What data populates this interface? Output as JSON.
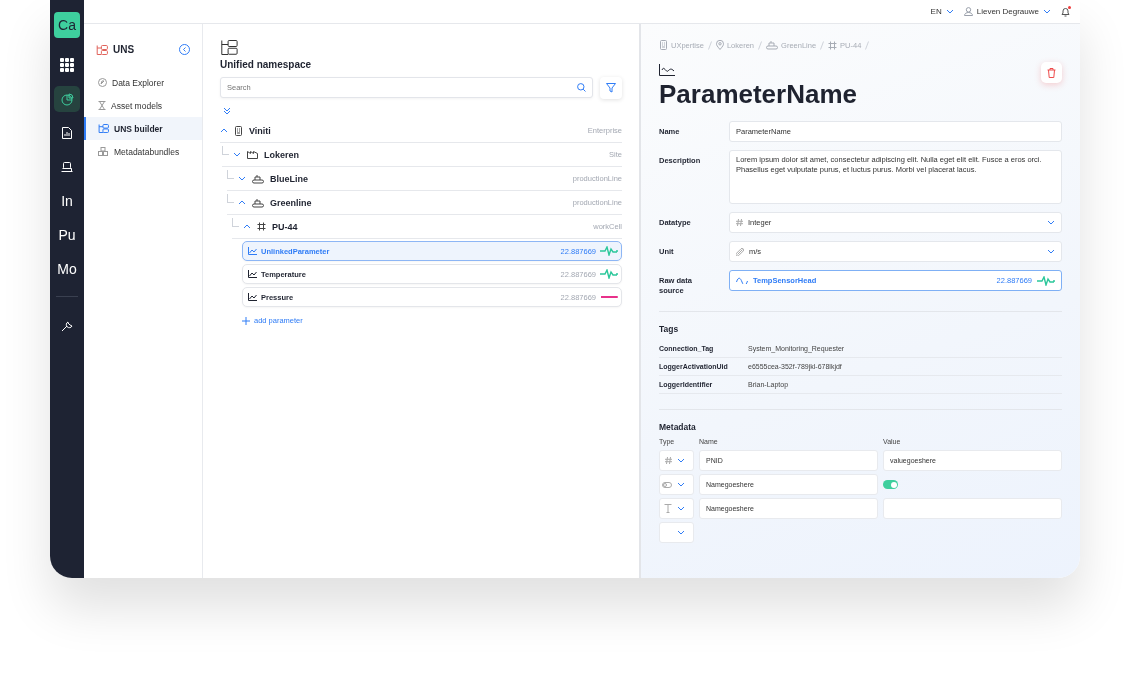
{
  "rail": {
    "logo": "Ca",
    "items": [
      {
        "kind": "grid",
        "selected": false
      },
      {
        "kind": "pie",
        "selected": true
      },
      {
        "kind": "report",
        "selected": false
      },
      {
        "kind": "device",
        "selected": false
      },
      {
        "kind": "text",
        "label": "In",
        "selected": false
      },
      {
        "kind": "text",
        "label": "Pu",
        "selected": false
      },
      {
        "kind": "text",
        "label": "Mo",
        "selected": false
      }
    ]
  },
  "top_bar": {
    "language": "EN",
    "user": "Lieven Degrauwe",
    "notifications_unread": true
  },
  "sidebar": {
    "title": "UNS",
    "items": [
      {
        "label": "Data Explorer",
        "kind": "compass",
        "selected": false
      },
      {
        "label": "Asset models",
        "kind": "hourglass",
        "selected": false
      },
      {
        "label": "UNS builder",
        "kind": "tree",
        "selected": true
      },
      {
        "label": "Metadatabundles",
        "kind": "cubes",
        "selected": false
      }
    ]
  },
  "tree": {
    "title": "Unified namespace",
    "search": {
      "placeholder": "Search"
    },
    "nodes": [
      {
        "name": "Viniti",
        "type": "Enterprise",
        "kind": "building",
        "expanded": true,
        "children": [
          {
            "name": "Lokeren",
            "type": "Site",
            "kind": "factory",
            "expanded": false,
            "children": [
              {
                "name": "BlueLine",
                "type": "productionLine",
                "kind": "line",
                "expanded": false
              },
              {
                "name": "Greenline",
                "type": "productionLine",
                "kind": "line",
                "expanded": true,
                "children": [
                  {
                    "name": "PU-44",
                    "type": "workCell",
                    "kind": "cell",
                    "expanded": true,
                    "parameters": [
                      {
                        "name": "UnlinkedParameter",
                        "value": "22.887669",
                        "selected": true,
                        "kind": "wave",
                        "color": "#2bc79a"
                      },
                      {
                        "name": "Temperature",
                        "value": "22.887669",
                        "selected": false,
                        "kind": "wave",
                        "color": "#2bc79a"
                      },
                      {
                        "name": "Pressure",
                        "value": "22.887669",
                        "selected": false,
                        "kind": "flat",
                        "color": "#e8318a"
                      }
                    ]
                  }
                ]
              }
            ]
          }
        ]
      }
    ],
    "add_label": "add parameter"
  },
  "detail": {
    "breadcrumb": [
      {
        "label": "UXpertise",
        "kind": "building"
      },
      {
        "label": "Lokeren",
        "kind": "pin"
      },
      {
        "label": "GreenLine",
        "kind": "line"
      },
      {
        "label": "PU-44",
        "kind": "cell"
      }
    ],
    "title": "ParameterName",
    "fields": [
      {
        "label": "Name",
        "kind": "input",
        "value": "ParameterName"
      },
      {
        "label": "Description",
        "kind": "textarea",
        "value": "Lorem ipsum dolor sit amet, consectetur adipiscing elit. Nulla eget elit elit. Fusce a eros orci. Phasellus eget vulputate purus, et luctus purus. Morbi vel placerat lacus."
      },
      {
        "label": "Datatype",
        "kind": "type_select",
        "value": "Integer"
      },
      {
        "label": "Unit",
        "kind": "unit_select",
        "value": "m/s"
      },
      {
        "label": "Raw data source",
        "kind": "source",
        "value": "TempSensorHead",
        "reading": "22.887669",
        "color": "#2bc79a"
      }
    ],
    "tags": {
      "title": "Tags",
      "rows": [
        {
          "key": "Connection_Tag",
          "value": "System_Monitoring_Requester"
        },
        {
          "key": "LoggerActivationUid",
          "value": "e6555cea-352f-789jkl-678lkjdf"
        },
        {
          "key": "LoggerIdentifier",
          "value": "Brian-Laptop"
        }
      ]
    },
    "metadata": {
      "title": "Metadata",
      "columns": [
        "Type",
        "Name",
        "Value"
      ],
      "rows": [
        {
          "kind": "number",
          "name": "PNID",
          "value": "valuegoeshere"
        },
        {
          "kind": "toggle",
          "name": "Namegoeshere",
          "on": true
        },
        {
          "kind": "text",
          "name": "Namegoeshere",
          "value": ""
        },
        {
          "kind": "empty"
        }
      ]
    }
  }
}
